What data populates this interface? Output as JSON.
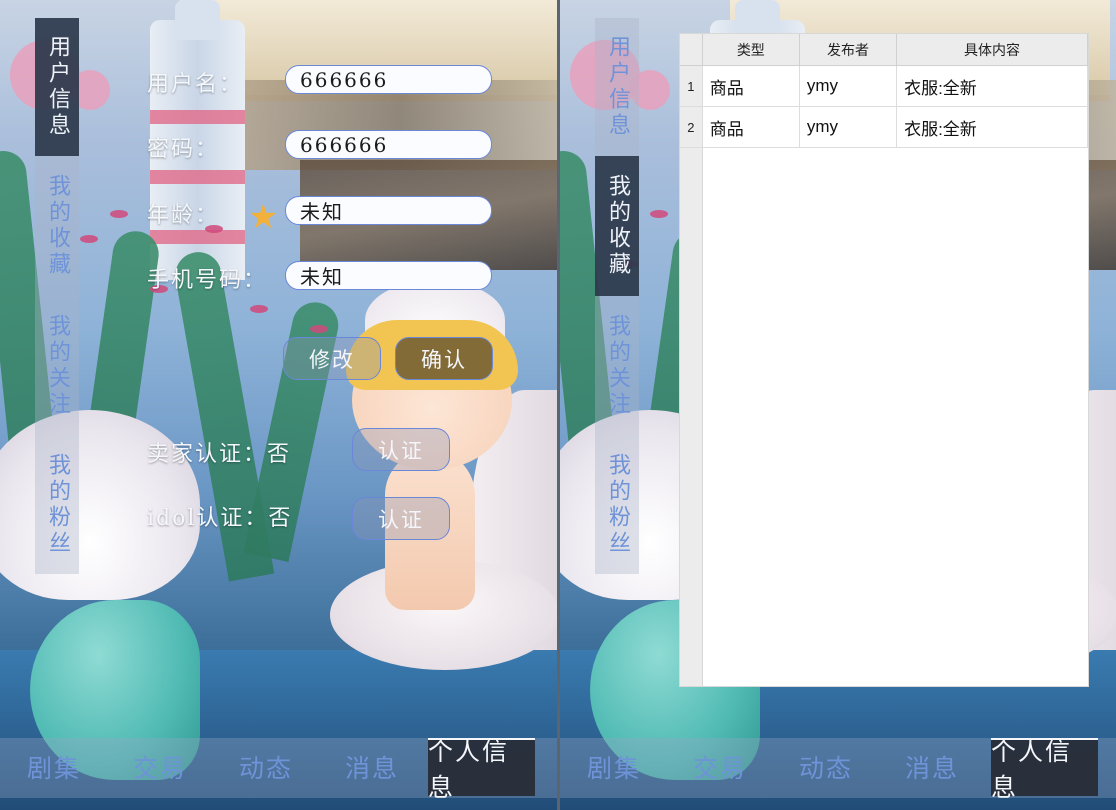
{
  "left": {
    "side_tabs": [
      {
        "label": "用户信息",
        "active": true
      },
      {
        "label": "我的收藏",
        "active": false
      },
      {
        "label": "我的关注",
        "active": false
      },
      {
        "label": "我的粉丝",
        "active": false
      }
    ],
    "form": {
      "username_label": "用户名：",
      "username_value": "666666",
      "password_label": "密码：",
      "password_value": "666666",
      "age_label": "年龄：",
      "age_value": "未知",
      "phone_label": "手机号码：",
      "phone_value": "未知",
      "modify_button": "修改",
      "confirm_button": "确认",
      "seller_cert_text": "卖家认证：否",
      "seller_cert_button": "认证",
      "idol_cert_text": "idol认证：否",
      "idol_cert_button": "认证"
    },
    "bottom_nav": [
      {
        "label": "剧集",
        "active": false
      },
      {
        "label": "交易",
        "active": false
      },
      {
        "label": "动态",
        "active": false
      },
      {
        "label": "消息",
        "active": false
      },
      {
        "label": "个人信息",
        "active": true
      }
    ]
  },
  "right": {
    "side_tabs": [
      {
        "label": "用户信息",
        "active": false
      },
      {
        "label": "我的收藏",
        "active": true
      },
      {
        "label": "我的关注",
        "active": false
      },
      {
        "label": "我的粉丝",
        "active": false
      }
    ],
    "table": {
      "columns": [
        "类型",
        "发布者",
        "具体内容"
      ],
      "rows": [
        {
          "num": "1",
          "cells": [
            "商品",
            "ymy",
            "衣服:全新"
          ]
        },
        {
          "num": "2",
          "cells": [
            "商品",
            "ymy",
            "衣服:全新"
          ]
        }
      ]
    },
    "bottom_nav": [
      {
        "label": "剧集",
        "active": false
      },
      {
        "label": "交易",
        "active": false
      },
      {
        "label": "动态",
        "active": false
      },
      {
        "label": "消息",
        "active": false
      },
      {
        "label": "个人信息",
        "active": true
      }
    ]
  },
  "colors": {
    "accent_blue": "#6f93d8",
    "active_tab_bg": "#263244",
    "input_border": "#6a87d8"
  }
}
